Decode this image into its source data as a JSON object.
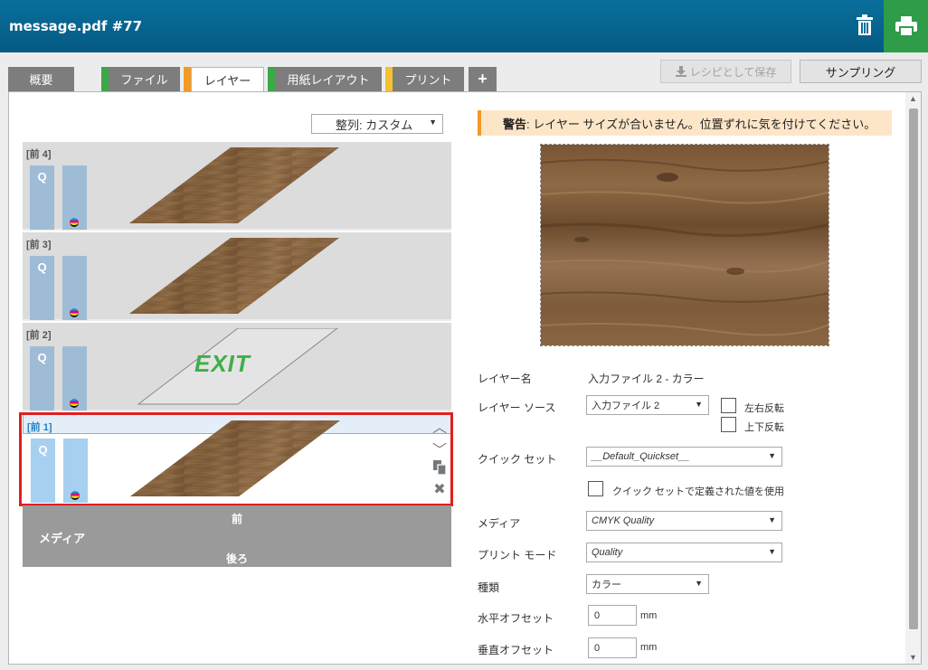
{
  "window": {
    "title": "message.pdf #77"
  },
  "toolbar": {
    "trash_icon": "trash-icon",
    "print_icon": "printer-icon"
  },
  "tabs": [
    {
      "label": "概要",
      "mark": ""
    },
    {
      "label": "ファイル",
      "mark": "#3ba84a"
    },
    {
      "label": "レイヤー",
      "mark": "#f29a26"
    },
    {
      "label": "用紙レイアウト",
      "mark": "#3ba84a"
    },
    {
      "label": "プリント",
      "mark": "#f2c230"
    },
    {
      "label": "+",
      "mark": ""
    }
  ],
  "actions": {
    "save_recipe": "レシピとして保存",
    "sampling": "サンプリング"
  },
  "sort": {
    "value": "整列: カスタム"
  },
  "layers": [
    {
      "label": "[前 4]",
      "q": "Q",
      "content": "wood"
    },
    {
      "label": "[前 3]",
      "q": "Q",
      "content": "wood"
    },
    {
      "label": "[前 2]",
      "q": "Q",
      "content": "EXIT"
    },
    {
      "label": "[前 1]",
      "q": "Q",
      "content": "wood",
      "selected": true
    }
  ],
  "media": {
    "front": "前",
    "label": "メディア",
    "back": "後ろ"
  },
  "warning": {
    "bold": "警告",
    "text": ": レイヤー サイズが合いません。位置ずれに気を付けてください。"
  },
  "form": {
    "layer_name_label": "レイヤー名",
    "layer_name_value": "入力ファイル 2 - カラー",
    "layer_source_label": "レイヤー ソース",
    "layer_source_value": "入力ファイル 2",
    "flip_h": "左右反転",
    "flip_v": "上下反転",
    "quickset_label": "クイック セット",
    "quickset_value": "__Default_Quickset__",
    "quickset_use": "クイック セットで定義された値を使用",
    "media_label": "メディア",
    "media_value": "CMYK Quality",
    "print_mode_label": "プリント モード",
    "print_mode_value": "Quality",
    "type_label": "種類",
    "type_value": "カラー",
    "h_offset_label": "水平オフセット",
    "h_offset_value": "0",
    "v_offset_label": "垂直オフセット",
    "v_offset_value": "0",
    "unit": "mm"
  },
  "colors": {
    "header": "#045a82",
    "print": "#2e9c48",
    "selection": "#e0201e",
    "warning_bg": "#fde6c8"
  }
}
